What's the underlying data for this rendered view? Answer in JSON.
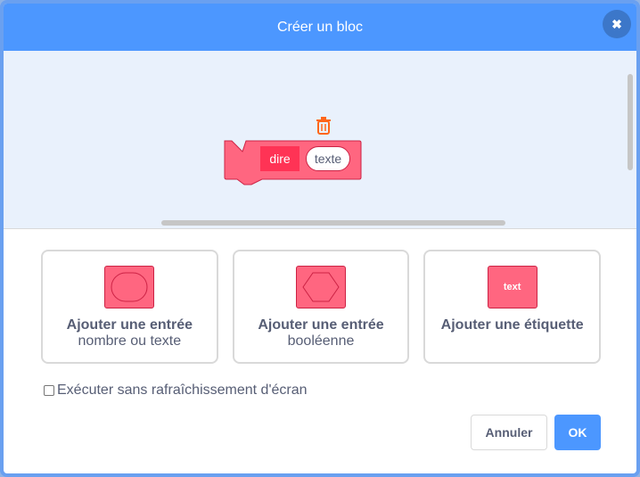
{
  "dialog": {
    "title": "Créer un bloc",
    "close_icon": "close-icon"
  },
  "workspace": {
    "block": {
      "label": "dire",
      "input_text": "texte"
    },
    "trash_icon": "trash-icon"
  },
  "options": [
    {
      "title": "Ajouter une entrée",
      "subtitle": "nombre ou texte",
      "icon": "number-text-input-icon"
    },
    {
      "title": "Ajouter une entrée",
      "subtitle": "booléenne",
      "icon": "boolean-input-icon"
    },
    {
      "title": "Ajouter une étiquette",
      "subtitle": "",
      "icon": "label-icon",
      "icon_text": "text"
    }
  ],
  "checkbox": {
    "label": "Exécuter sans rafraîchissement d'écran",
    "checked": false
  },
  "buttons": {
    "cancel": "Annuler",
    "ok": "OK"
  },
  "colors": {
    "header": "#4c97ff",
    "block": "#ff6680",
    "block_dark": "#ff3355",
    "workspace_bg": "#e9f1fc"
  }
}
